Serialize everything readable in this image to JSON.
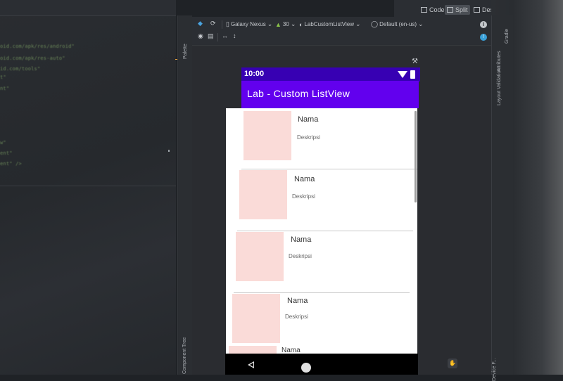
{
  "top_bar": {
    "code_label": "Code",
    "split_label": "Split",
    "design_label": "Design"
  },
  "toolbar": {
    "device_label": "Galaxy Nexus",
    "api_label": "30",
    "theme_label": "LabCustomListView",
    "locale_label": "Default (en-us)"
  },
  "side_tabs": {
    "palette": "Palette",
    "component_tree": "Component Tree",
    "attributes": "Attributes",
    "layout_validation": "Layout Validation",
    "gradle": "Gradle",
    "device_file": "Device F..."
  },
  "editor": {
    "lines": [
      {
        "text": "oid.com/apk/res/android\"",
        "color": "#6a8759"
      },
      {
        "text": "oid.com/apk/res-auto\"",
        "color": "#6a8759"
      },
      {
        "text": "id.com/tools\"",
        "color": "#6a8759"
      },
      {
        "text": "t\"",
        "color": "#6a8759"
      },
      {
        "text": "nt\"",
        "color": "#6a8759"
      },
      {
        "text": "w\"",
        "color": "#6a8759"
      },
      {
        "text": "ent\"",
        "color": "#6a8759"
      },
      {
        "text": "ent\" />",
        "color": "#6a8759"
      }
    ]
  },
  "phone": {
    "time": "10:00",
    "app_title": "Lab - Custom ListView",
    "items": [
      {
        "title": "Nama",
        "description": "Deskripsi"
      },
      {
        "title": "Nama",
        "description": "Deskripsi"
      },
      {
        "title": "Nama",
        "description": "Deskripsi"
      },
      {
        "title": "Nama",
        "description": "Deskripsi"
      },
      {
        "title": "Nama",
        "description": ""
      }
    ]
  },
  "colors": {
    "status_bar": "#3700b3",
    "app_bar": "#6200ee",
    "thumbnail": "#fadbd8"
  }
}
